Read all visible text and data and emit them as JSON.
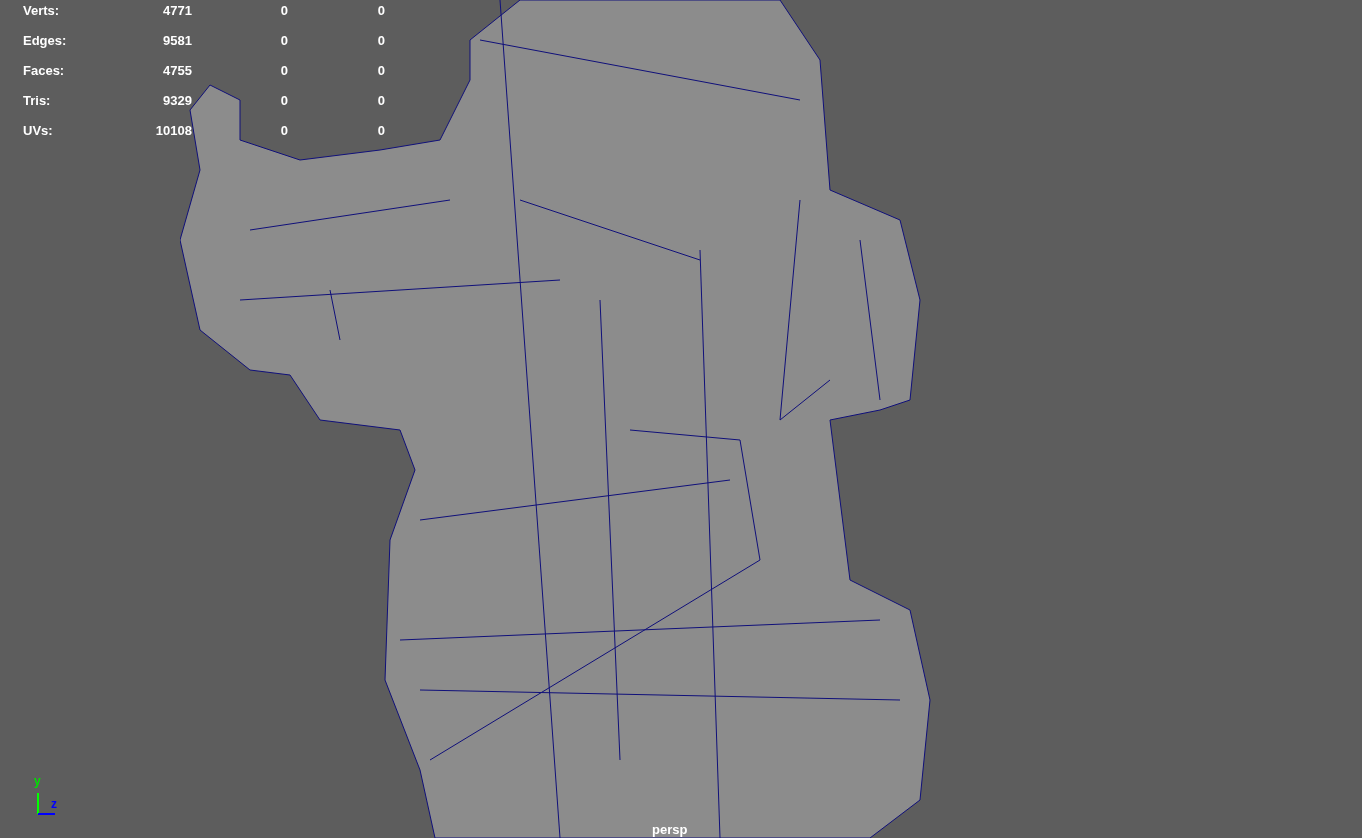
{
  "hud": {
    "rows": [
      {
        "label": "Verts:",
        "values": [
          "4771",
          "0",
          "0"
        ]
      },
      {
        "label": "Edges:",
        "values": [
          "9581",
          "0",
          "0"
        ]
      },
      {
        "label": "Faces:",
        "values": [
          "4755",
          "0",
          "0"
        ]
      },
      {
        "label": "Tris:",
        "values": [
          "9329",
          "0",
          "0"
        ]
      },
      {
        "label": "UVs:",
        "values": [
          "10108",
          "0",
          "0"
        ]
      }
    ]
  },
  "axis": {
    "y": "y",
    "z": "z"
  },
  "camera": "persp"
}
